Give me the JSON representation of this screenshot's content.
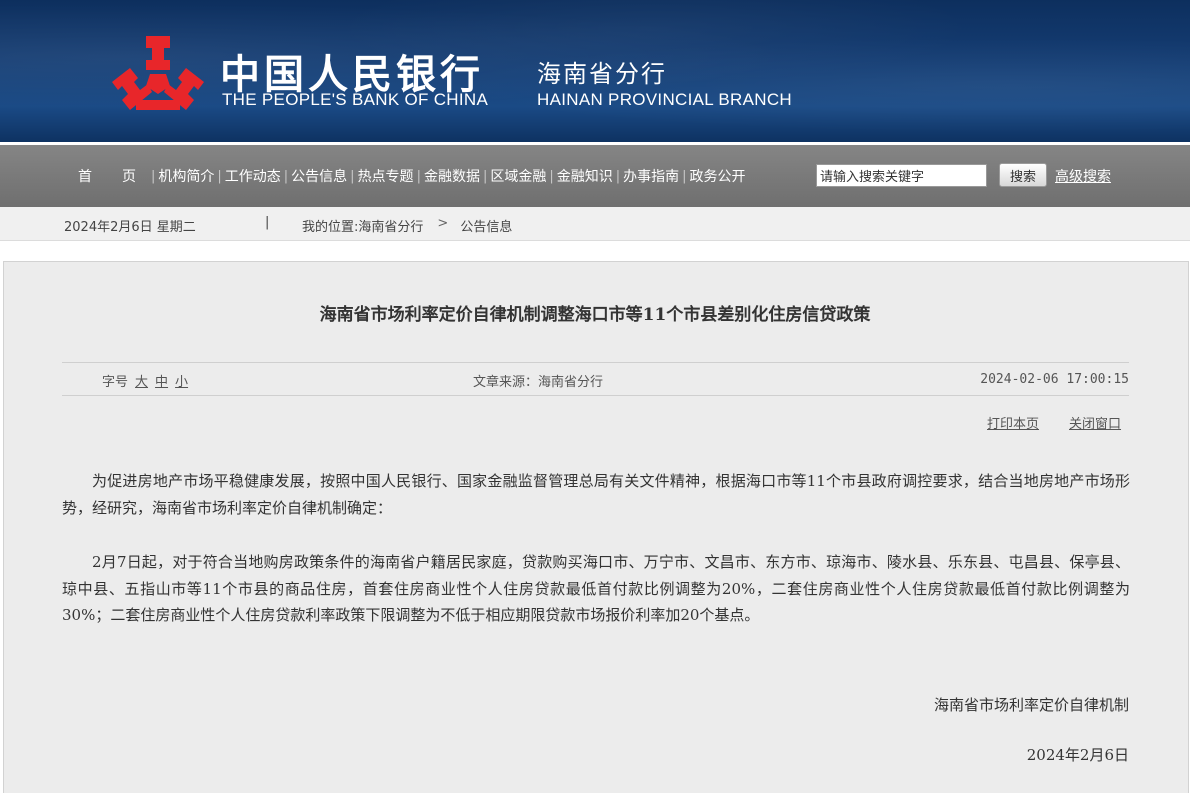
{
  "header": {
    "bank_name_cn": "中国人民银行",
    "branch_name_cn": "海南省分行",
    "bank_name_en": "THE PEOPLE'S BANK OF CHINA",
    "branch_name_en": "HAINAN PROVINCIAL BRANCH",
    "logo_color": "#e8262a"
  },
  "nav": {
    "items": [
      "首页",
      "机构简介",
      "工作动态",
      "公告信息",
      "热点专题",
      "金融数据",
      "区域金融",
      "金融知识",
      "办事指南",
      "政务公开"
    ],
    "search_placeholder": "请输入搜索关键字",
    "search_button": "搜索",
    "advanced_search": "高级搜索"
  },
  "location": {
    "date": "2024年2月6日  星期二",
    "separator": "|",
    "label": "我的位置:",
    "crumb_home": "海南省分行",
    "arrow": ">",
    "crumb_current": "公告信息"
  },
  "article": {
    "title": "海南省市场利率定价自律机制调整海口市等11个市县差别化住房信贷政策",
    "font_size_label": "字号",
    "font_sizes": [
      "大",
      "中",
      "小"
    ],
    "source": "文章来源：海南省分行",
    "time": "2024-02-06 17:00:15",
    "print": "打印本页",
    "close": "关闭窗口",
    "paragraphs": [
      "为促进房地产市场平稳健康发展，按照中国人民银行、国家金融监督管理总局有关文件精神，根据海口市等11个市县政府调控要求，结合当地房地产市场形势，经研究，海南省市场利率定价自律机制确定：",
      "2月7日起，对于符合当地购房政策条件的海南省户籍居民家庭，贷款购买海口市、万宁市、文昌市、东方市、琼海市、陵水县、乐东县、屯昌县、保亭县、琼中县、五指山市等11个市县的商品住房，首套住房商业性个人住房贷款最低首付款比例调整为20%，二套住房商业性个人住房贷款最低首付款比例调整为30%；二套住房商业性个人住房贷款利率政策下限调整为不低于相应期限贷款市场报价利率加20个基点。"
    ],
    "signature": "海南省市场利率定价自律机制",
    "sign_date": "2024年2月6日"
  }
}
